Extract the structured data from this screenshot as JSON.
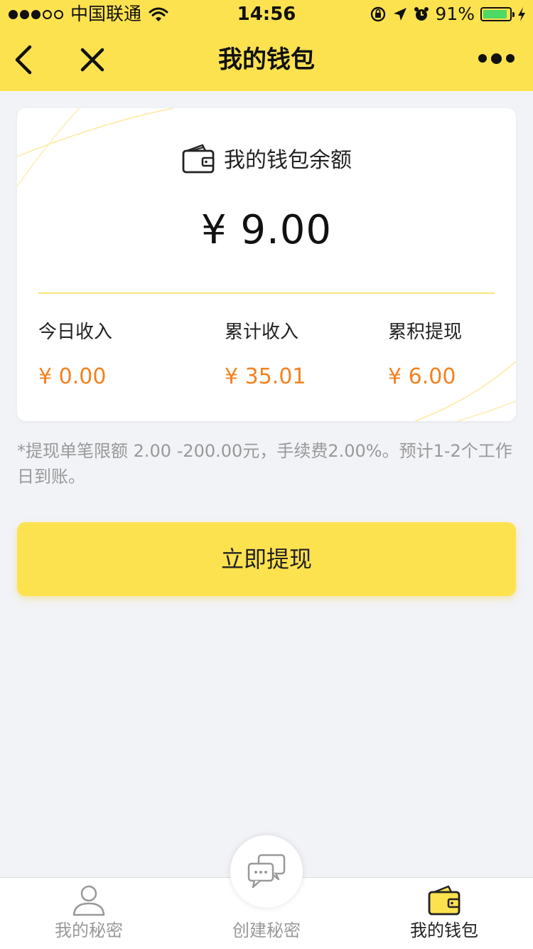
{
  "status_bar": {
    "carrier": "中国联通",
    "time": "14:56",
    "battery_percent": "91%",
    "battery_level": 0.91
  },
  "nav": {
    "title": "我的钱包"
  },
  "balance_card": {
    "title": "我的钱包余额",
    "amount": "¥ 9.00",
    "stats": [
      {
        "label": "今日收入",
        "value": "¥ 0.00"
      },
      {
        "label": "累计收入",
        "value": "¥ 35.01"
      },
      {
        "label": "累积提现",
        "value": "¥ 6.00"
      }
    ]
  },
  "note": "*提现单笔限额 2.00 -200.00元，手续费2.00%。预计1-2个工作日到账。",
  "withdraw_button": "立即提现",
  "tabbar": {
    "items": [
      {
        "label": "我的秘密",
        "icon": "user-icon"
      },
      {
        "label": "创建秘密",
        "icon": "chat-bubbles-icon"
      },
      {
        "label": "我的钱包",
        "icon": "wallet-icon"
      }
    ],
    "active_index": 2
  },
  "colors": {
    "brand_yellow": "#fde250",
    "amount_orange": "#f5811f",
    "background": "#f2f3f7"
  }
}
